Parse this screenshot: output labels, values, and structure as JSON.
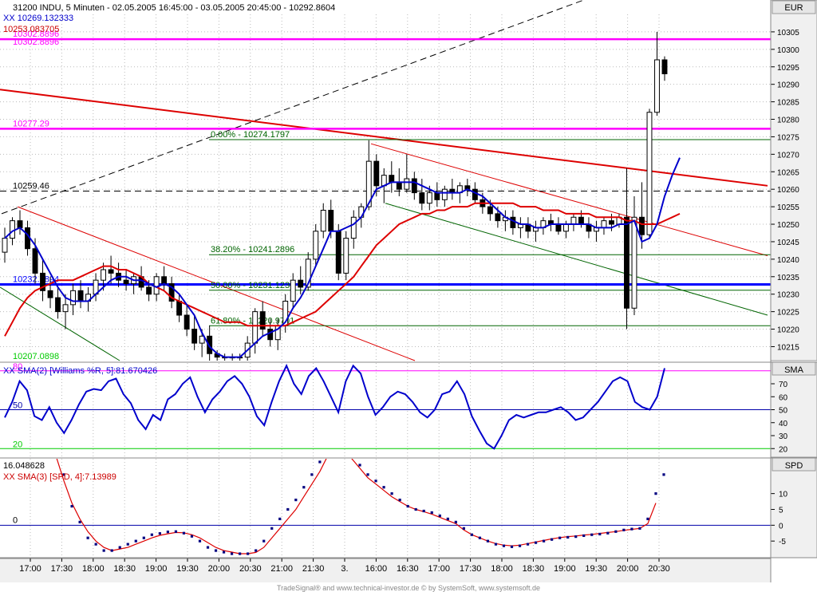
{
  "header": {
    "line1": "31200  INDU, 5 Minuten - 02.05.2005 16:45:00 - 03.05.2005 20:45:00 - 10292.8604",
    "line2": "XX 10269.132333",
    "line3": "10253.083705",
    "line4": "10302.8896"
  },
  "footer": "TradeSignal® and www.technical-investor.de © by  SystemSoft, www.systemsoft.de",
  "colors": {
    "background": "#ffffff",
    "axis_panel": "#f0f0f0",
    "candle": "#000000",
    "sma_blue": "#0000cc",
    "sma_red": "#dd0000",
    "magenta": "#ff00ff",
    "green": "#006400",
    "dots": "#000080"
  },
  "chart_data": [
    {
      "type": "candlestick",
      "panel": "price",
      "axis_label": "EUR",
      "ylim": [
        10211,
        10310
      ],
      "yticks": [
        10215,
        10220,
        10225,
        10230,
        10235,
        10240,
        10245,
        10250,
        10255,
        10260,
        10265,
        10270,
        10275,
        10280,
        10285,
        10290,
        10295,
        10300,
        10305
      ],
      "xticks": [
        "17:00",
        "17:30",
        "18:00",
        "18:30",
        "19:00",
        "19:30",
        "20:00",
        "20:30",
        "21:00",
        "21:30",
        "3.",
        "16:00",
        "16:30",
        "17:00",
        "17:30",
        "18:00",
        "18:30",
        "19:00",
        "19:30",
        "20:00",
        "20:30"
      ],
      "bars": [
        {
          "o": 10242,
          "h": 10249,
          "l": 10239,
          "c": 10246
        },
        {
          "o": 10246,
          "h": 10252,
          "l": 10244,
          "c": 10251
        },
        {
          "o": 10251,
          "h": 10254,
          "l": 10247,
          "c": 10249
        },
        {
          "o": 10249,
          "h": 10251,
          "l": 10241,
          "c": 10243
        },
        {
          "o": 10243,
          "h": 10246,
          "l": 10233,
          "c": 10236
        },
        {
          "o": 10236,
          "h": 10240,
          "l": 10228,
          "c": 10231
        },
        {
          "o": 10231,
          "h": 10235,
          "l": 10226,
          "c": 10229
        },
        {
          "o": 10229,
          "h": 10232,
          "l": 10223,
          "c": 10225
        },
        {
          "o": 10225,
          "h": 10230,
          "l": 10220,
          "c": 10227
        },
        {
          "o": 10227,
          "h": 10233,
          "l": 10224,
          "c": 10231
        },
        {
          "o": 10231,
          "h": 10234,
          "l": 10226,
          "c": 10228
        },
        {
          "o": 10228,
          "h": 10232,
          "l": 10225,
          "c": 10230
        },
        {
          "o": 10230,
          "h": 10236,
          "l": 10228,
          "c": 10234
        },
        {
          "o": 10234,
          "h": 10239,
          "l": 10231,
          "c": 10237
        },
        {
          "o": 10237,
          "h": 10241,
          "l": 10233,
          "c": 10236
        },
        {
          "o": 10236,
          "h": 10239,
          "l": 10232,
          "c": 10234
        },
        {
          "o": 10234,
          "h": 10237,
          "l": 10231,
          "c": 10233
        },
        {
          "o": 10233,
          "h": 10236,
          "l": 10230,
          "c": 10235
        },
        {
          "o": 10235,
          "h": 10238,
          "l": 10231,
          "c": 10232
        },
        {
          "o": 10232,
          "h": 10234,
          "l": 10228,
          "c": 10230
        },
        {
          "o": 10230,
          "h": 10236,
          "l": 10228,
          "c": 10235
        },
        {
          "o": 10235,
          "h": 10238,
          "l": 10231,
          "c": 10233
        },
        {
          "o": 10233,
          "h": 10235,
          "l": 10226,
          "c": 10228
        },
        {
          "o": 10228,
          "h": 10230,
          "l": 10222,
          "c": 10224
        },
        {
          "o": 10224,
          "h": 10227,
          "l": 10218,
          "c": 10220
        },
        {
          "o": 10220,
          "h": 10224,
          "l": 10214,
          "c": 10216
        },
        {
          "o": 10216,
          "h": 10220,
          "l": 10212,
          "c": 10218
        },
        {
          "o": 10218,
          "h": 10221,
          "l": 10211,
          "c": 10213
        },
        {
          "o": 10213,
          "h": 10214,
          "l": 10211,
          "c": 10212
        },
        {
          "o": 10212,
          "h": 10213,
          "l": 10211,
          "c": 10212
        },
        {
          "o": 10212,
          "h": 10213,
          "l": 10211,
          "c": 10212
        },
        {
          "o": 10212,
          "h": 10213,
          "l": 10211,
          "c": 10212
        },
        {
          "o": 10212,
          "h": 10218,
          "l": 10211,
          "c": 10216
        },
        {
          "o": 10216,
          "h": 10226,
          "l": 10213,
          "c": 10225
        },
        {
          "o": 10225,
          "h": 10228,
          "l": 10218,
          "c": 10220
        },
        {
          "o": 10220,
          "h": 10223,
          "l": 10215,
          "c": 10217
        },
        {
          "o": 10217,
          "h": 10223,
          "l": 10214,
          "c": 10221
        },
        {
          "o": 10221,
          "h": 10230,
          "l": 10219,
          "c": 10228
        },
        {
          "o": 10228,
          "h": 10236,
          "l": 10226,
          "c": 10234
        },
        {
          "o": 10234,
          "h": 10238,
          "l": 10230,
          "c": 10232
        },
        {
          "o": 10232,
          "h": 10242,
          "l": 10231,
          "c": 10240
        },
        {
          "o": 10240,
          "h": 10250,
          "l": 10238,
          "c": 10248
        },
        {
          "o": 10248,
          "h": 10256,
          "l": 10246,
          "c": 10254
        },
        {
          "o": 10254,
          "h": 10257,
          "l": 10246,
          "c": 10248
        },
        {
          "o": 10248,
          "h": 10250,
          "l": 10234,
          "c": 10236
        },
        {
          "o": 10236,
          "h": 10248,
          "l": 10234,
          "c": 10246
        },
        {
          "o": 10246,
          "h": 10254,
          "l": 10243,
          "c": 10252
        },
        {
          "o": 10252,
          "h": 10256,
          "l": 10249,
          "c": 10255
        },
        {
          "o": 10255,
          "h": 10274,
          "l": 10254,
          "c": 10268
        },
        {
          "o": 10268,
          "h": 10270,
          "l": 10258,
          "c": 10261
        },
        {
          "o": 10261,
          "h": 10266,
          "l": 10256,
          "c": 10264
        },
        {
          "o": 10264,
          "h": 10268,
          "l": 10259,
          "c": 10262
        },
        {
          "o": 10262,
          "h": 10266,
          "l": 10258,
          "c": 10260
        },
        {
          "o": 10260,
          "h": 10270,
          "l": 10259,
          "c": 10263
        },
        {
          "o": 10263,
          "h": 10265,
          "l": 10257,
          "c": 10259
        },
        {
          "o": 10259,
          "h": 10263,
          "l": 10254,
          "c": 10256
        },
        {
          "o": 10256,
          "h": 10261,
          "l": 10254,
          "c": 10259
        },
        {
          "o": 10259,
          "h": 10262,
          "l": 10255,
          "c": 10257
        },
        {
          "o": 10257,
          "h": 10261,
          "l": 10255,
          "c": 10260
        },
        {
          "o": 10260,
          "h": 10263,
          "l": 10257,
          "c": 10259
        },
        {
          "o": 10259,
          "h": 10262,
          "l": 10256,
          "c": 10261
        },
        {
          "o": 10261,
          "h": 10263,
          "l": 10258,
          "c": 10260
        },
        {
          "o": 10260,
          "h": 10262,
          "l": 10256,
          "c": 10257
        },
        {
          "o": 10257,
          "h": 10259,
          "l": 10253,
          "c": 10255
        },
        {
          "o": 10255,
          "h": 10257,
          "l": 10251,
          "c": 10253
        },
        {
          "o": 10253,
          "h": 10255,
          "l": 10249,
          "c": 10251
        },
        {
          "o": 10251,
          "h": 10254,
          "l": 10248,
          "c": 10252
        },
        {
          "o": 10252,
          "h": 10254,
          "l": 10247,
          "c": 10249
        },
        {
          "o": 10249,
          "h": 10252,
          "l": 10246,
          "c": 10250
        },
        {
          "o": 10250,
          "h": 10252,
          "l": 10246,
          "c": 10248
        },
        {
          "o": 10248,
          "h": 10251,
          "l": 10245,
          "c": 10249
        },
        {
          "o": 10249,
          "h": 10252,
          "l": 10247,
          "c": 10251
        },
        {
          "o": 10251,
          "h": 10253,
          "l": 10248,
          "c": 10250
        },
        {
          "o": 10250,
          "h": 10252,
          "l": 10247,
          "c": 10248
        },
        {
          "o": 10248,
          "h": 10251,
          "l": 10246,
          "c": 10250
        },
        {
          "o": 10250,
          "h": 10253,
          "l": 10248,
          "c": 10252
        },
        {
          "o": 10252,
          "h": 10254,
          "l": 10249,
          "c": 10250
        },
        {
          "o": 10250,
          "h": 10252,
          "l": 10246,
          "c": 10248
        },
        {
          "o": 10248,
          "h": 10251,
          "l": 10245,
          "c": 10249
        },
        {
          "o": 10249,
          "h": 10252,
          "l": 10247,
          "c": 10251
        },
        {
          "o": 10251,
          "h": 10253,
          "l": 10248,
          "c": 10250
        },
        {
          "o": 10250,
          "h": 10253,
          "l": 10249,
          "c": 10252
        },
        {
          "o": 10252,
          "h": 10266,
          "l": 10220,
          "c": 10226
        },
        {
          "o": 10226,
          "h": 10258,
          "l": 10224,
          "c": 10252
        },
        {
          "o": 10252,
          "h": 10262,
          "l": 10243,
          "c": 10247
        },
        {
          "o": 10247,
          "h": 10283,
          "l": 10246,
          "c": 10282
        },
        {
          "o": 10282,
          "h": 10305,
          "l": 10281,
          "c": 10297
        },
        {
          "o": 10297,
          "h": 10298,
          "l": 10291,
          "c": 10293
        }
      ],
      "sma_blue": [
        10246,
        10248,
        10249,
        10247,
        10244,
        10240,
        10236,
        10232,
        10229,
        10228,
        10228,
        10228,
        10230,
        10232,
        10234,
        10235,
        10235,
        10234,
        10234,
        10233,
        10232,
        10233,
        10232,
        10230,
        10227,
        10224,
        10219,
        10215,
        10213,
        10212,
        10212,
        10212,
        10214,
        10216,
        10218,
        10219,
        10220,
        10222,
        10226,
        10229,
        10233,
        10238,
        10243,
        10248,
        10248,
        10249,
        10250,
        10252,
        10256,
        10260,
        10261,
        10262,
        10262,
        10262,
        10262,
        10261,
        10260,
        10259,
        10259,
        10259,
        10259,
        10260,
        10259,
        10258,
        10256,
        10254,
        10252,
        10251,
        10250,
        10250,
        10249,
        10249,
        10250,
        10250,
        10250,
        10250,
        10250,
        10250,
        10249,
        10249,
        10249,
        10250,
        10250,
        10251,
        10245,
        10246,
        10250,
        10258,
        10264,
        10269
      ],
      "sma_red": [
        10218,
        10222,
        10226,
        10229,
        10231,
        10232,
        10233,
        10234,
        10234,
        10234,
        10235,
        10236,
        10237,
        10238,
        10238,
        10237,
        10237,
        10236,
        10235,
        10233,
        10232,
        10231,
        10229,
        10228,
        10227,
        10226,
        10225,
        10224,
        10223,
        10222,
        10222,
        10222,
        10221,
        10221,
        10221,
        10221,
        10221,
        10221,
        10222,
        10223,
        10224,
        10225,
        10227,
        10229,
        10231,
        10233,
        10235,
        10238,
        10241,
        10244,
        10246,
        10248,
        10250,
        10251,
        10252,
        10253,
        10253,
        10254,
        10254,
        10255,
        10255,
        10255,
        10256,
        10256,
        10256,
        10256,
        10256,
        10256,
        10255,
        10255,
        10255,
        10254,
        10254,
        10254,
        10253,
        10253,
        10253,
        10253,
        10252,
        10252,
        10252,
        10252,
        10251,
        10251,
        10250,
        10250,
        10250,
        10251,
        10252,
        10253
      ],
      "levels": [
        {
          "label": "10302.8896",
          "value": 10302.89,
          "color": "#ff00ff"
        },
        {
          "label": "10277.29",
          "value": 10277.29,
          "color": "#ff00ff"
        },
        {
          "label": "0.00% - 10274.1797",
          "value": 10274.18,
          "color": "#006400"
        },
        {
          "label": "10259.46",
          "value": 10259.46,
          "color": "#000000"
        },
        {
          "label": "38.20% - 10241.2896",
          "value": 10241.29,
          "color": "#006400"
        },
        {
          "label": "10232.7894",
          "value": 10232.79,
          "color": "#0000ff"
        },
        {
          "label": "50.00% - 10231.1230",
          "value": 10231.12,
          "color": "#006400"
        },
        {
          "label": "61.80% - 10220.9701",
          "value": 10220.97,
          "color": "#006400"
        },
        {
          "label": "10207.0898",
          "value": 10207.09,
          "color": "#00cc00"
        }
      ]
    },
    {
      "type": "line",
      "panel": "williams",
      "axis_label": "SMA",
      "title": "XX SMA(2) [Williams %R, 5]:81.670426",
      "ylim": [
        14,
        86
      ],
      "yticks": [
        20,
        30,
        40,
        50,
        60,
        70
      ],
      "levels": [
        {
          "label": "80",
          "value": 80
        },
        {
          "label": "50",
          "value": 50
        },
        {
          "label": "20",
          "value": 20
        }
      ],
      "values": [
        44,
        56,
        72,
        65,
        45,
        42,
        52,
        40,
        32,
        42,
        54,
        64,
        66,
        65,
        72,
        74,
        62,
        55,
        42,
        35,
        46,
        42,
        58,
        62,
        70,
        75,
        60,
        48,
        58,
        64,
        72,
        76,
        70,
        60,
        45,
        38,
        56,
        72,
        84,
        70,
        62,
        76,
        82,
        72,
        60,
        48,
        72,
        84,
        78,
        60,
        46,
        52,
        60,
        64,
        62,
        56,
        48,
        44,
        50,
        62,
        64,
        72,
        62,
        45,
        34,
        24,
        20,
        30,
        42,
        46,
        44,
        46,
        48,
        48,
        50,
        52,
        48,
        42,
        44,
        50,
        56,
        64,
        72,
        75,
        72,
        56,
        52,
        50,
        60,
        82
      ]
    },
    {
      "type": "scatter_line",
      "panel": "spd",
      "axis_label": "SPD",
      "title": "XX SMA(3) [SPD, 4]:7.13989",
      "subtitle": "16.048628",
      "ylim": [
        -10,
        21
      ],
      "yticks": [
        -5,
        0,
        5,
        10
      ],
      "zero_label": "0",
      "dots": [
        30,
        24,
        16,
        6,
        1,
        -4,
        -6,
        -8,
        -8,
        -7,
        -6,
        -5,
        -4,
        -3,
        -2.6,
        -2.1,
        -2.0,
        -2.5,
        -3.5,
        -5,
        -7,
        -8,
        -8.5,
        -9,
        -9,
        -9,
        -8,
        -5,
        -1,
        2,
        5,
        8,
        12,
        16,
        20,
        28,
        30,
        26,
        22,
        19,
        16,
        14,
        12,
        10,
        8,
        6,
        5,
        4.5,
        4,
        3,
        2,
        1,
        -1,
        -3,
        -4,
        -5,
        -6,
        -6.5,
        -6.8,
        -6.5,
        -6,
        -5.5,
        -5,
        -4.5,
        -4,
        -3.8,
        -3.6,
        -3.3,
        -3,
        -2.8,
        -2.5,
        -2,
        -1.5,
        -1.2,
        -1,
        2,
        10,
        16
      ],
      "line": [
        28,
        22,
        14,
        7,
        2,
        -2,
        -5,
        -7,
        -8,
        -7.5,
        -7,
        -6,
        -5,
        -4,
        -3.2,
        -2.7,
        -2.3,
        -2.4,
        -3,
        -4,
        -5.5,
        -7,
        -8,
        -8.5,
        -9,
        -9,
        -8.6,
        -7,
        -4,
        -1,
        2,
        5,
        9,
        13,
        17,
        22,
        26,
        24,
        21,
        18,
        15,
        13,
        11,
        9,
        7.5,
        6,
        5,
        4.3,
        3.5,
        2.5,
        1.5,
        0.5,
        -1.5,
        -3,
        -4,
        -5,
        -5.8,
        -6.3,
        -6.5,
        -6.3,
        -5.8,
        -5.3,
        -4.8,
        -4.3,
        -3.9,
        -3.6,
        -3.4,
        -3.1,
        -2.9,
        -2.6,
        -2.3,
        -2,
        -1.6,
        -1.3,
        -1,
        0.5,
        7
      ]
    }
  ]
}
